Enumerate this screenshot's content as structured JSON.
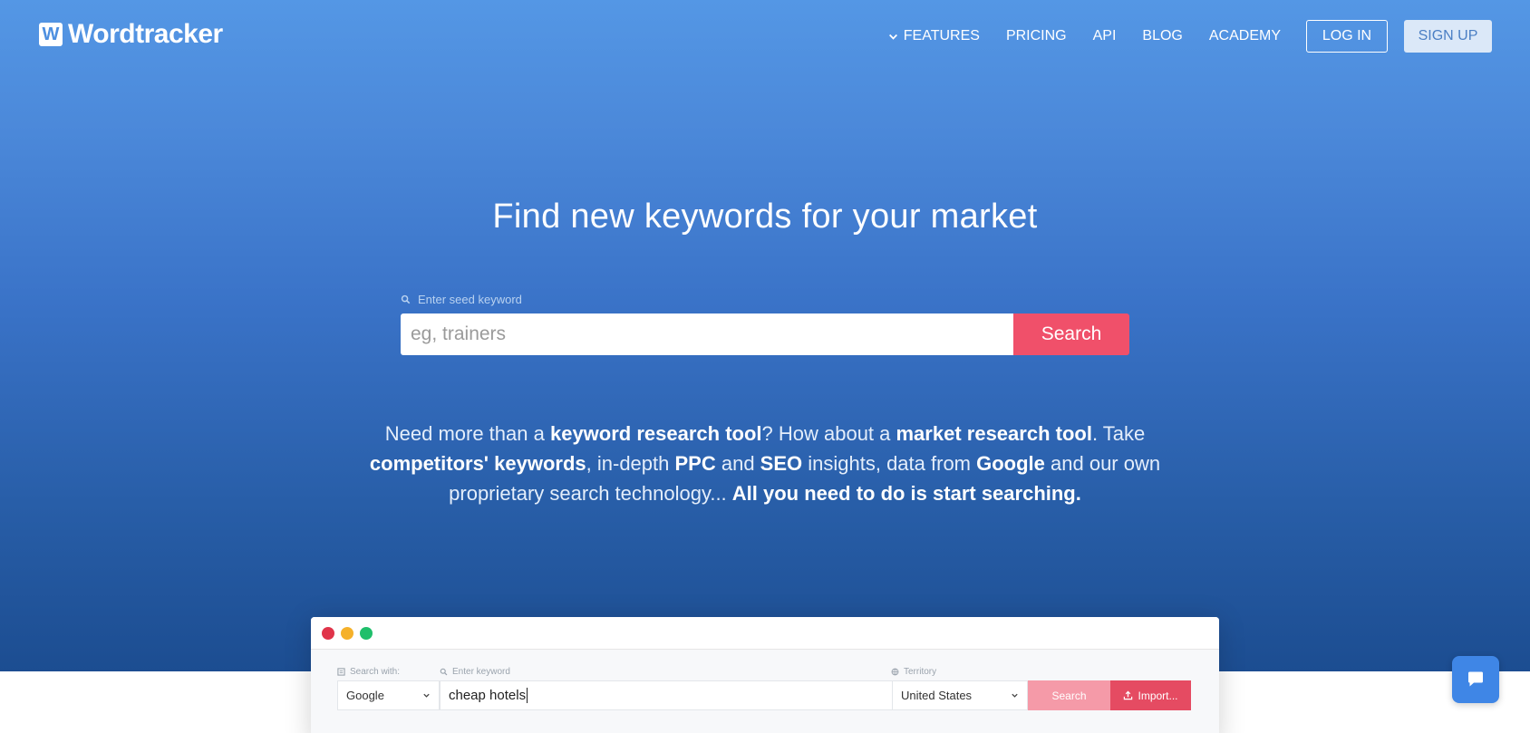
{
  "brand": {
    "logo_mark": "W",
    "name": "Wordtracker"
  },
  "nav": {
    "features": "FEATURES",
    "pricing": "PRICING",
    "api": "API",
    "blog": "BLOG",
    "academy": "ACADEMY",
    "login": "LOG IN",
    "signup": "SIGN UP"
  },
  "hero": {
    "headline": "Find new keywords for your market",
    "seed_label": "Enter seed keyword",
    "search_placeholder": "eg, trainers",
    "search_button": "Search",
    "pitch": [
      {
        "t": "Need more than a ",
        "b": false
      },
      {
        "t": "keyword research tool",
        "b": true
      },
      {
        "t": "? How about a ",
        "b": false
      },
      {
        "t": "market research tool",
        "b": true
      },
      {
        "t": ". Take ",
        "b": false
      },
      {
        "t": "competitors' keywords",
        "b": true
      },
      {
        "t": ", in-depth ",
        "b": false
      },
      {
        "t": "PPC",
        "b": true
      },
      {
        "t": " and ",
        "b": false
      },
      {
        "t": "SEO",
        "b": true
      },
      {
        "t": " insights, data from ",
        "b": false
      },
      {
        "t": "Google",
        "b": true
      },
      {
        "t": " and our own proprietary search technology... ",
        "b": false
      },
      {
        "t": "All you need to do is start searching.",
        "b": true
      }
    ]
  },
  "preview": {
    "search_with_label": "Search with:",
    "search_with_value": "Google",
    "keyword_label": "Enter keyword",
    "keyword_value": "cheap hotels",
    "territory_label": "Territory",
    "territory_value": "United States",
    "search_button": "Search",
    "import_button": "Import..."
  },
  "colors": {
    "accent_red": "#f0506a",
    "hero_top": "#5497e5",
    "hero_bottom": "#1c4d91",
    "dot_red": "#e0344a",
    "dot_yellow": "#f5b12a",
    "dot_green": "#1fbf6b",
    "chat_blue": "#3f86e6"
  },
  "icons": {
    "chevron": "chevron-down-icon",
    "search": "search-icon",
    "chat": "chat-icon",
    "import": "upload-icon",
    "territory": "globe-icon",
    "search_with": "list-icon"
  }
}
